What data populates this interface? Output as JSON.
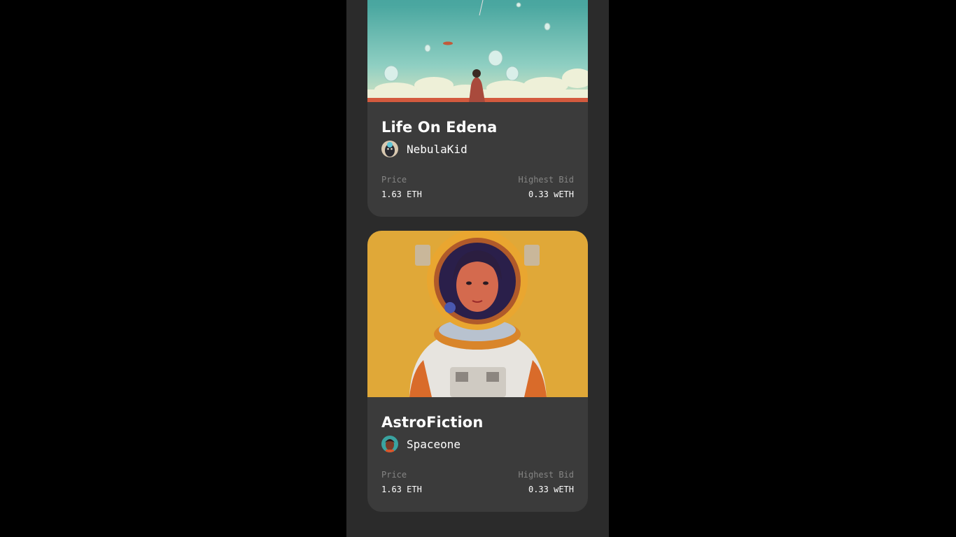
{
  "cards": [
    {
      "title": "Life On Edena",
      "artist": "NebulaKid",
      "price_label": "Price",
      "price_value": "1.63 ETH",
      "bid_label": "Highest Bid",
      "bid_value": "0.33 wETH"
    },
    {
      "title": "AstroFiction",
      "artist": "Spaceone",
      "price_label": "Price",
      "price_value": "1.63 ETH",
      "bid_label": "Highest Bid",
      "bid_value": "0.33 wETH"
    }
  ],
  "colors": {
    "page_bg": "#000000",
    "panel_bg": "#2b2b2b",
    "card_bg": "#3b3b3b",
    "label": "#858584",
    "text": "#ffffff"
  }
}
